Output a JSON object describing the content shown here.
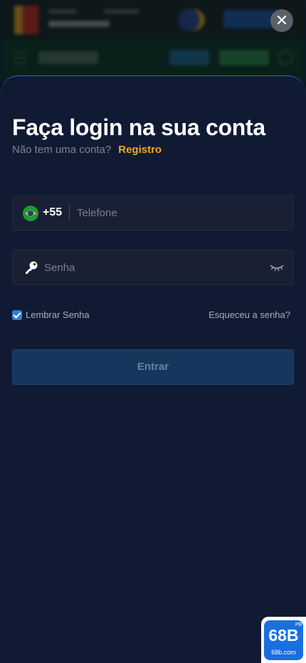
{
  "background": {
    "promo_label": "",
    "nav_logo": ""
  },
  "modal": {
    "close_glyph": "✕",
    "title": "Faça login na sua conta",
    "subtitle_text": "Não tem uma conta?",
    "register_link": "Registro",
    "phone": {
      "country_code": "+55",
      "placeholder": "Telefone",
      "value": "",
      "flag_icon": "brazil-flag-icon"
    },
    "password": {
      "placeholder": "Senha",
      "value": "",
      "icon": "key-icon",
      "toggle_icon": "eye-closed-icon"
    },
    "remember": {
      "label": "Lembrar Senha",
      "checked": true
    },
    "forgot_link": "Esqueceu a senha?",
    "submit_label": "Entrar"
  },
  "watermark": {
    "brand": "68B",
    "domain": "68b.com",
    "tag": "PB"
  },
  "colors": {
    "sheet_bg": "#101a33",
    "accent_link": "#f5a623",
    "checkbox": "#2e7fd6",
    "submit_bg": "#17365e"
  }
}
